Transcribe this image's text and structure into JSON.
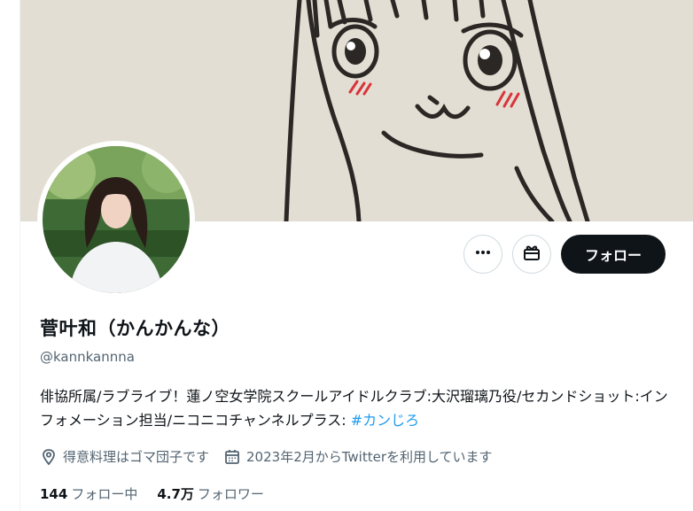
{
  "profile": {
    "display_name": "菅叶和（かんかんな）",
    "handle": "@kannkannna",
    "bio_text": "俳協所属/ラブライブ！蓮ノ空女学院スクールアイドルクラブ:大沢瑠璃乃役/セカンドショット:インフォメーション担当/ニコニコチャンネルプラス: ",
    "bio_hashtag": "#カンじろ",
    "location": "得意料理はゴマ団子です",
    "joined": "2023年2月からTwitterを利用しています",
    "following_count": "144",
    "following_label": "フォロー中",
    "followers_count": "4.7万",
    "followers_label": "フォロワー"
  },
  "actions": {
    "more_icon": "more-icon",
    "gift_icon": "gift-icon",
    "follow_label": "フォロー"
  },
  "colors": {
    "text": "#0f1419",
    "secondary": "#536471",
    "link": "#1d9bf0",
    "banner_bg": "#e6e1d7"
  }
}
